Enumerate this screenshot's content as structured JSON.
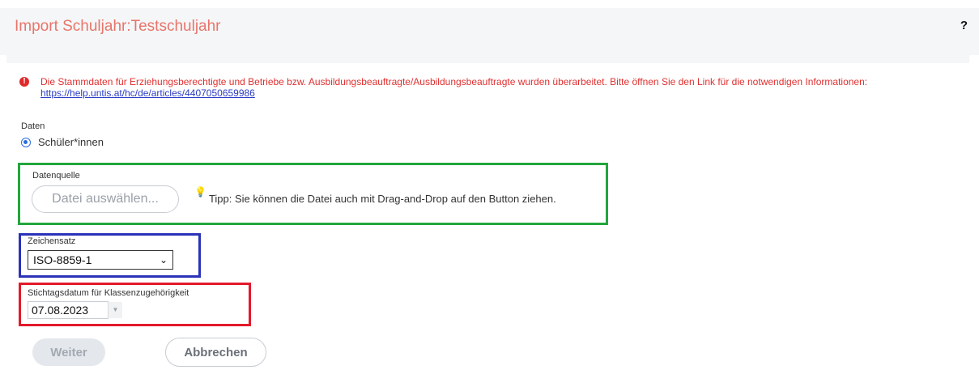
{
  "header": {
    "title": "Import Schuljahr:Testschuljahr",
    "help": "?"
  },
  "alert": {
    "icon": "!",
    "text": "Die Stammdaten für Erziehungsberechtigte und Betriebe bzw. Ausbildungsbeauftragte/Ausbildungsbeauftragte wurden überarbeitet. Bitte öffnen Sie den Link für die notwendigen Informationen: ",
    "link": "https://help.untis.at/hc/de/articles/4407050659986"
  },
  "daten": {
    "label": "Daten",
    "option": "Schüler*innen"
  },
  "datenquelle": {
    "label": "Datenquelle",
    "button": "Datei auswählen...",
    "tip": "Tipp: Sie können die Datei auch mit Drag-and-Drop auf den Button ziehen."
  },
  "zeichensatz": {
    "label": "Zeichensatz",
    "value": "ISO-8859-1"
  },
  "stichtag": {
    "label": "Stichtagsdatum für Klassenzugehörigkeit",
    "value": "07.08.2023"
  },
  "actions": {
    "next": "Weiter",
    "cancel": "Abbrechen"
  },
  "colors": {
    "title": "#e8756a",
    "alert": "#e03030",
    "highlight_green": "#22a63c",
    "highlight_blue": "#2b32b8",
    "highlight_red": "#e3192b"
  }
}
